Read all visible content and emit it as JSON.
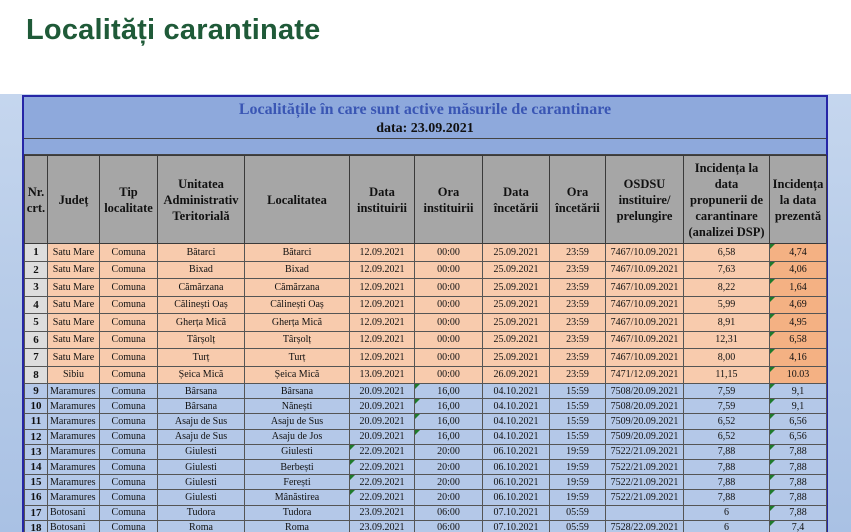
{
  "page": {
    "title": "Localități carantinate"
  },
  "sheet": {
    "banner_title": "Localitățile în care sunt active măsurile de carantinare",
    "banner_date": "data: 23.09.2021"
  },
  "table": {
    "columns": [
      "Nr. crt.",
      "Județ",
      "Tip localitate",
      "Unitatea Administrativ Teritorială",
      "Localitatea",
      "Data instituirii",
      "Ora instituirii",
      "Data încetării",
      "Ora încetării",
      "OSDSU instituire/ prelungire",
      "Incidența la data propunerii de carantinare (analizei DSP)",
      "Incidența la data prezentă"
    ],
    "rows": [
      [
        "1",
        "Satu Mare",
        "Comuna",
        "Bătarci",
        "Bătarci",
        "12.09.2021",
        "00:00",
        "25.09.2021",
        "23:59",
        "7467/10.09.2021",
        "6,58",
        "4,74"
      ],
      [
        "2",
        "Satu Mare",
        "Comuna",
        "Bixad",
        "Bixad",
        "12.09.2021",
        "00:00",
        "25.09.2021",
        "23:59",
        "7467/10.09.2021",
        "7,63",
        "4,06"
      ],
      [
        "3",
        "Satu Mare",
        "Comuna",
        "Cămărzana",
        "Cămărzana",
        "12.09.2021",
        "00:00",
        "25.09.2021",
        "23:59",
        "7467/10.09.2021",
        "8,22",
        "1,64"
      ],
      [
        "4",
        "Satu Mare",
        "Comuna",
        "Călinești Oaș",
        "Călinești Oaș",
        "12.09.2021",
        "00:00",
        "25.09.2021",
        "23:59",
        "7467/10.09.2021",
        "5,99",
        "4,69"
      ],
      [
        "5",
        "Satu Mare",
        "Comuna",
        "Gherța Mică",
        "Gherța Mică",
        "12.09.2021",
        "00:00",
        "25.09.2021",
        "23:59",
        "7467/10.09.2021",
        "8,91",
        "4,95"
      ],
      [
        "6",
        "Satu Mare",
        "Comuna",
        "Târșolț",
        "Târșolț",
        "12.09.2021",
        "00:00",
        "25.09.2021",
        "23:59",
        "7467/10.09.2021",
        "12,31",
        "6,58"
      ],
      [
        "7",
        "Satu Mare",
        "Comuna",
        "Turț",
        "Turț",
        "12.09.2021",
        "00:00",
        "25.09.2021",
        "23:59",
        "7467/10.09.2021",
        "8,00",
        "4,16"
      ],
      [
        "8",
        "Sibiu",
        "Comuna",
        "Șeica Mică",
        "Șeica Mică",
        "13.09.2021",
        "00:00",
        "26.09.2021",
        "23:59",
        "7471/12.09.2021",
        "11,15",
        "10.03"
      ],
      [
        "9",
        "Maramures",
        "Comuna",
        "Bârsana",
        "Bârsana",
        "20.09.2021",
        "16,00",
        "04.10.2021",
        "15:59",
        "7508/20.09.2021",
        "7,59",
        "9,1"
      ],
      [
        "10",
        "Maramures",
        "Comuna",
        "Bârsana",
        "Nănești",
        "20.09.2021",
        "16,00",
        "04.10.2021",
        "15:59",
        "7508/20.09.2021",
        "7,59",
        "9,1"
      ],
      [
        "11",
        "Maramures",
        "Comuna",
        "Asaju de Sus",
        "Asaju de Sus",
        "20.09.2021",
        "16,00",
        "04.10.2021",
        "15:59",
        "7509/20.09.2021",
        "6,52",
        "6,56"
      ],
      [
        "12",
        "Maramures",
        "Comuna",
        "Asaju de Sus",
        "Asaju de Jos",
        "20.09.2021",
        "16,00",
        "04.10.2021",
        "15:59",
        "7509/20.09.2021",
        "6,52",
        "6,56"
      ],
      [
        "13",
        "Maramures",
        "Comuna",
        "Giulesti",
        "Giulesti",
        "22.09.2021",
        "20:00",
        "06.10.2021",
        "19:59",
        "7522/21.09.2021",
        "7,88",
        "7,88"
      ],
      [
        "14",
        "Maramures",
        "Comuna",
        "Giulesti",
        "Berbești",
        "22.09.2021",
        "20:00",
        "06.10.2021",
        "19:59",
        "7522/21.09.2021",
        "7,88",
        "7,88"
      ],
      [
        "15",
        "Maramures",
        "Comuna",
        "Giulesti",
        "Ferești",
        "22.09.2021",
        "20:00",
        "06.10.2021",
        "19:59",
        "7522/21.09.2021",
        "7,88",
        "7,88"
      ],
      [
        "16",
        "Maramures",
        "Comuna",
        "Giulesti",
        "Mânăstirea",
        "22.09.2021",
        "20:00",
        "06.10.2021",
        "19:59",
        "7522/21.09.2021",
        "7,88",
        "7,88"
      ],
      [
        "17",
        "Botosani",
        "Comuna",
        "Tudora",
        "Tudora",
        "23.09.2021",
        "06:00",
        "07.10.2021",
        "05:59",
        "",
        "6",
        "7,88"
      ],
      [
        "18",
        "Botosani",
        "Comuna",
        "Roma",
        "Roma",
        "23.09.2021",
        "06:00",
        "07.10.2021",
        "05:59",
        "7528/22.09.2021",
        "6",
        "7,4"
      ]
    ]
  },
  "colors": {
    "title_green": "#1f5a38",
    "banner_blue": "#8ea9dc",
    "header_gray": "#a6a6a6",
    "row_peach": "#f8cbad",
    "row_blue": "#b4c8e8"
  }
}
